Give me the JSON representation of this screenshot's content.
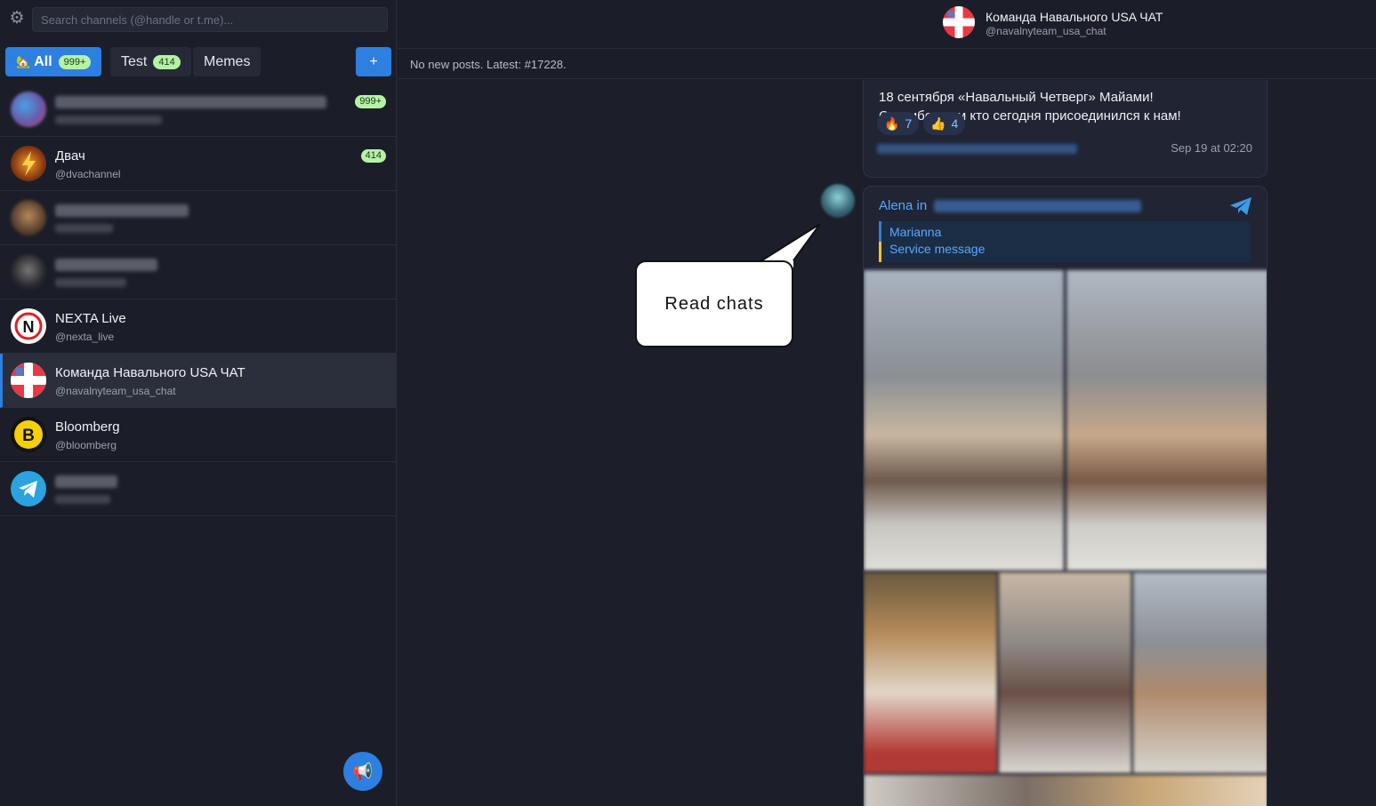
{
  "sidebar": {
    "search": {
      "placeholder": "Search channels (@handle or t.me)..."
    },
    "tabs": [
      {
        "label": "All",
        "emoji": "🏡",
        "count": "999+"
      },
      {
        "label": "Test",
        "count": "414"
      },
      {
        "label": "Memes"
      }
    ],
    "add_tab_label": "+",
    "chats": [
      {
        "name": "",
        "handle": "",
        "unread": "999+"
      },
      {
        "name": "Двач",
        "handle": "@dvachannel",
        "unread": "414"
      },
      {
        "name": "",
        "handle": ""
      },
      {
        "name": "",
        "handle": ""
      },
      {
        "name": "NEXTA Live",
        "handle": "@nexta_live"
      },
      {
        "name": "Команда Навального USA ЧАТ",
        "handle": "@navalnyteam_usa_chat"
      },
      {
        "name": "Bloomberg",
        "handle": "@bloomberg"
      },
      {
        "name": "",
        "handle": ""
      }
    ],
    "fab_icon": "megaphone-icon"
  },
  "header": {
    "title": "Команда Навального USA ЧАТ",
    "handle": "@navalnyteam_usa_chat"
  },
  "status": {
    "text": "No new posts. Latest: #17228."
  },
  "posts": [
    {
      "lines": [
        "18 сентября «Навальный Четверг» Майами!",
        "Спасибо всем кто сегодня присоединился к нам!"
      ],
      "reactions": [
        {
          "emoji": "🔥",
          "count": "7"
        },
        {
          "emoji": "👍",
          "count": "4"
        }
      ],
      "date": "Sep 19 at 02:20"
    },
    {
      "author": "Alena in",
      "reply": {
        "name": "Marianna",
        "text": "Service message"
      }
    }
  ],
  "callout": {
    "text": "Read chats"
  },
  "colors": {
    "accent": "#2d7fe0",
    "badge": "#b6f2a6",
    "link": "#5aa8ff"
  }
}
